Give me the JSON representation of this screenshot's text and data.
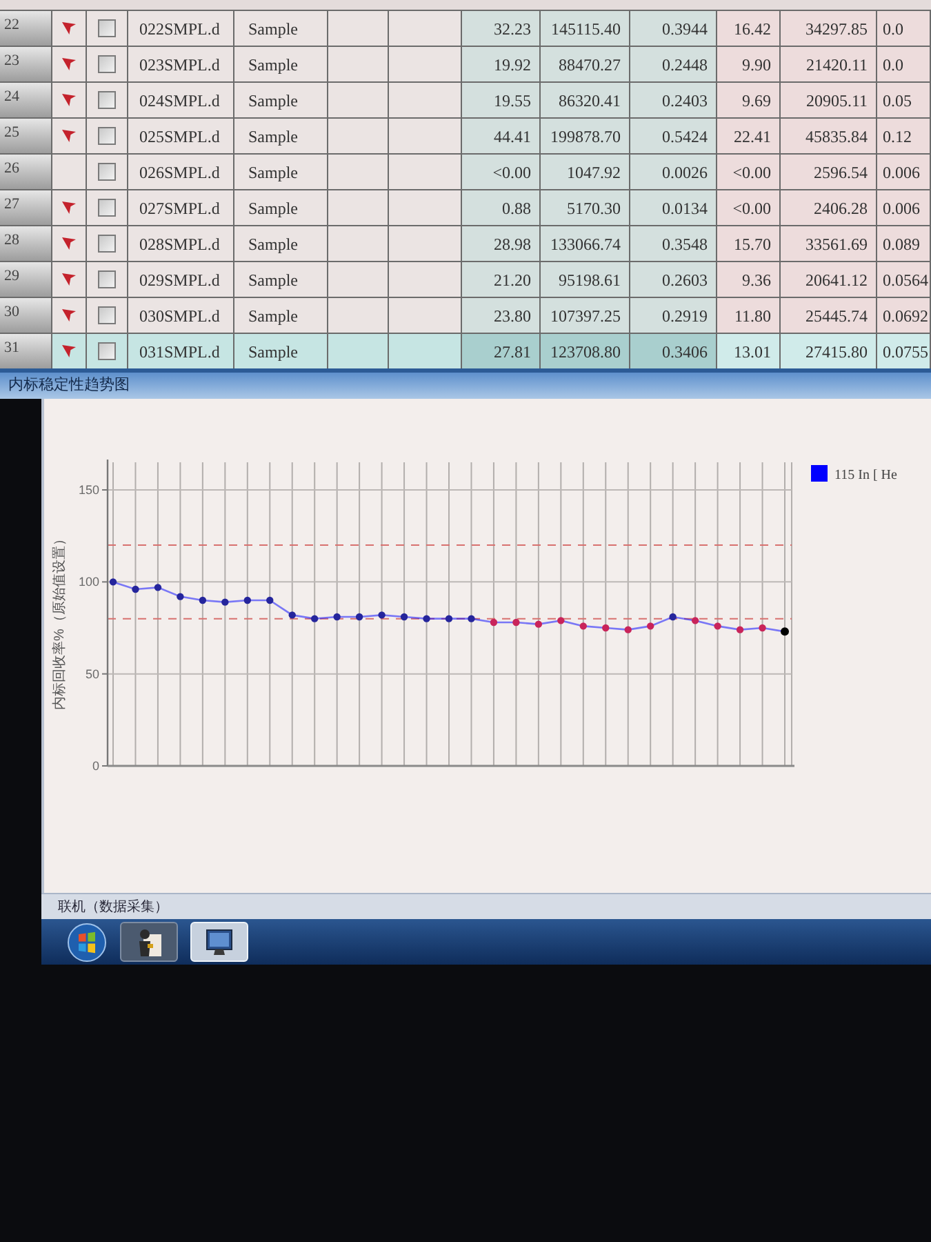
{
  "table": {
    "rows": [
      {
        "number": "22",
        "flagged": true,
        "checked": false,
        "selected": false,
        "file": "022SMPL.d",
        "type": "Sample",
        "values": [
          "32.23",
          "145115.40",
          "0.3944",
          "16.42",
          "34297.85",
          "0.0"
        ]
      },
      {
        "number": "23",
        "flagged": true,
        "checked": false,
        "selected": false,
        "file": "023SMPL.d",
        "type": "Sample",
        "values": [
          "19.92",
          "88470.27",
          "0.2448",
          "9.90",
          "21420.11",
          "0.0"
        ]
      },
      {
        "number": "24",
        "flagged": true,
        "checked": false,
        "selected": false,
        "file": "024SMPL.d",
        "type": "Sample",
        "values": [
          "19.55",
          "86320.41",
          "0.2403",
          "9.69",
          "20905.11",
          "0.05"
        ]
      },
      {
        "number": "25",
        "flagged": true,
        "checked": false,
        "selected": false,
        "file": "025SMPL.d",
        "type": "Sample",
        "values": [
          "44.41",
          "199878.70",
          "0.5424",
          "22.41",
          "45835.84",
          "0.12"
        ]
      },
      {
        "number": "26",
        "flagged": false,
        "checked": false,
        "selected": false,
        "file": "026SMPL.d",
        "type": "Sample",
        "values": [
          "<0.00",
          "1047.92",
          "0.0026",
          "<0.00",
          "2596.54",
          "0.006"
        ]
      },
      {
        "number": "27",
        "flagged": true,
        "checked": false,
        "selected": false,
        "file": "027SMPL.d",
        "type": "Sample",
        "values": [
          "0.88",
          "5170.30",
          "0.0134",
          "<0.00",
          "2406.28",
          "0.006"
        ]
      },
      {
        "number": "28",
        "flagged": true,
        "checked": false,
        "selected": false,
        "file": "028SMPL.d",
        "type": "Sample",
        "values": [
          "28.98",
          "133066.74",
          "0.3548",
          "15.70",
          "33561.69",
          "0.089"
        ]
      },
      {
        "number": "29",
        "flagged": true,
        "checked": false,
        "selected": false,
        "file": "029SMPL.d",
        "type": "Sample",
        "values": [
          "21.20",
          "95198.61",
          "0.2603",
          "9.36",
          "20641.12",
          "0.0564"
        ]
      },
      {
        "number": "30",
        "flagged": true,
        "checked": false,
        "selected": false,
        "file": "030SMPL.d",
        "type": "Sample",
        "values": [
          "23.80",
          "107397.25",
          "0.2919",
          "11.80",
          "25445.74",
          "0.0692"
        ]
      },
      {
        "number": "31",
        "flagged": true,
        "checked": false,
        "selected": true,
        "file": "031SMPL.d",
        "type": "Sample",
        "values": [
          "27.81",
          "123708.80",
          "0.3406",
          "13.01",
          "27415.80",
          "0.0755"
        ]
      }
    ]
  },
  "chart_window": {
    "title": "内标稳定性趋势图",
    "chart_data": {
      "type": "line",
      "ylabel": "内标回收率%（原始值设置）",
      "ylim": [
        0,
        165
      ],
      "yticks": [
        0,
        50,
        100,
        150
      ],
      "grid": true,
      "series": [
        {
          "name": "115 In [ He",
          "color": "#0000ff",
          "marker": "o",
          "values": [
            100,
            96,
            97,
            92,
            90,
            89,
            90,
            90,
            82,
            80,
            81,
            81,
            82,
            81,
            80,
            80,
            80,
            78,
            78,
            77,
            79,
            76,
            75,
            74,
            76,
            81,
            79,
            76,
            74,
            75,
            73
          ]
        }
      ],
      "ref_lines": [
        {
          "axis": "y",
          "value": 120,
          "color": "#d8716f"
        },
        {
          "axis": "y",
          "value": 80,
          "color": "#d8716f"
        }
      ]
    }
  },
  "status_bar": {
    "text": "联机（数据采集）"
  },
  "taskbar": {
    "apps": [
      {
        "kind": "program",
        "selected": false
      },
      {
        "kind": "window",
        "selected": true
      }
    ]
  }
}
